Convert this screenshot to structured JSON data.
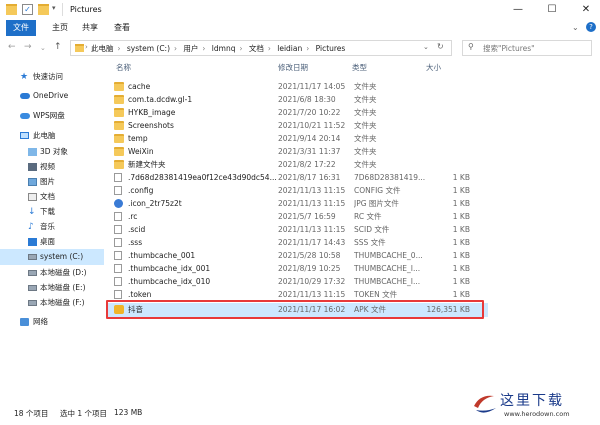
{
  "window": {
    "title": "Pictures"
  },
  "ribbon": {
    "tabs": [
      "文件",
      "主页",
      "共享",
      "查看"
    ]
  },
  "address": {
    "crumbs": [
      "此电脑",
      "system (C:)",
      "用户",
      "ldmnq",
      "文档",
      "leidian",
      "Pictures"
    ],
    "search_placeholder": "搜索\"Pictures\""
  },
  "sidebar": {
    "items": [
      {
        "label": "快速访问",
        "icon": "star-icon"
      },
      {
        "label": "OneDrive",
        "icon": "cloud-icon"
      },
      {
        "label": "WPS网盘",
        "icon": "wps-cloud-icon"
      },
      {
        "label": "此电脑",
        "icon": "computer-icon"
      },
      {
        "label": "3D 对象",
        "icon": "cube-icon"
      },
      {
        "label": "视频",
        "icon": "video-icon"
      },
      {
        "label": "图片",
        "icon": "picture-icon"
      },
      {
        "label": "文档",
        "icon": "document-icon"
      },
      {
        "label": "下载",
        "icon": "download-icon"
      },
      {
        "label": "音乐",
        "icon": "music-icon"
      },
      {
        "label": "桌面",
        "icon": "desktop-icon"
      },
      {
        "label": "system (C:)",
        "icon": "drive-icon",
        "selected": true
      },
      {
        "label": "本地磁盘 (D:)",
        "icon": "drive-icon"
      },
      {
        "label": "本地磁盘 (E:)",
        "icon": "drive-icon"
      },
      {
        "label": "本地磁盘 (F:)",
        "icon": "drive-icon"
      },
      {
        "label": "网络",
        "icon": "network-icon"
      }
    ]
  },
  "columns": {
    "name": "名称",
    "date": "修改日期",
    "type": "类型",
    "size": "大小"
  },
  "files": [
    {
      "name": "cache",
      "date": "2021/11/17 14:05",
      "type": "文件夹",
      "size": "",
      "kind": "folder"
    },
    {
      "name": "com.ta.dcdw.gl-1",
      "date": "2021/6/8 18:30",
      "type": "文件夹",
      "size": "",
      "kind": "folder"
    },
    {
      "name": "HYKB_image",
      "date": "2021/7/20 10:22",
      "type": "文件夹",
      "size": "",
      "kind": "folder"
    },
    {
      "name": "Screenshots",
      "date": "2021/10/21 11:52",
      "type": "文件夹",
      "size": "",
      "kind": "folder"
    },
    {
      "name": "temp",
      "date": "2021/9/14 20:14",
      "type": "文件夹",
      "size": "",
      "kind": "folder"
    },
    {
      "name": "WeiXin",
      "date": "2021/3/31 11:37",
      "type": "文件夹",
      "size": "",
      "kind": "folder"
    },
    {
      "name": "新建文件夹",
      "date": "2021/8/2 17:22",
      "type": "文件夹",
      "size": "",
      "kind": "folder"
    },
    {
      "name": ".7d68d28381419ea0f12ce43d90dc54...",
      "date": "2021/8/17 16:31",
      "type": "7D68D28381419...",
      "size": "1 KB",
      "kind": "file"
    },
    {
      "name": ".config",
      "date": "2021/11/13 11:15",
      "type": "CONFIG 文件",
      "size": "1 KB",
      "kind": "file"
    },
    {
      "name": ".icon_2tr75z2t",
      "date": "2021/11/13 11:15",
      "type": "JPG 图片文件",
      "size": "1 KB",
      "kind": "image"
    },
    {
      "name": ".rc",
      "date": "2021/5/7 16:59",
      "type": "RC 文件",
      "size": "1 KB",
      "kind": "file"
    },
    {
      "name": ".scid",
      "date": "2021/11/13 11:15",
      "type": "SCID 文件",
      "size": "1 KB",
      "kind": "file"
    },
    {
      "name": ".sss",
      "date": "2021/11/17 14:43",
      "type": "SSS 文件",
      "size": "1 KB",
      "kind": "file"
    },
    {
      "name": ".thumbcache_001",
      "date": "2021/5/28 10:58",
      "type": "THUMBCACHE_0...",
      "size": "1 KB",
      "kind": "file"
    },
    {
      "name": ".thumbcache_idx_001",
      "date": "2021/8/19 10:25",
      "type": "THUMBCACHE_I...",
      "size": "1 KB",
      "kind": "file"
    },
    {
      "name": ".thumbcache_idx_010",
      "date": "2021/10/29 17:32",
      "type": "THUMBCACHE_I...",
      "size": "1 KB",
      "kind": "file"
    },
    {
      "name": ".token",
      "date": "2021/11/13 11:15",
      "type": "TOKEN 文件",
      "size": "1 KB",
      "kind": "file"
    },
    {
      "name": "抖音",
      "date": "2021/11/17 16:02",
      "type": "APK 文件",
      "size": "126,351 KB",
      "kind": "apk",
      "selected": true
    }
  ],
  "status": {
    "count": "18 个项目",
    "selected": "选中 1 个项目",
    "size": "123 MB"
  },
  "watermark": {
    "text": "这里下载",
    "url": "www.herodown.com"
  },
  "colors": {
    "accent": "#1e6fc8",
    "selection": "#cce8ff",
    "highlight_box": "#e83a3a",
    "folder": "#f5c95a"
  }
}
